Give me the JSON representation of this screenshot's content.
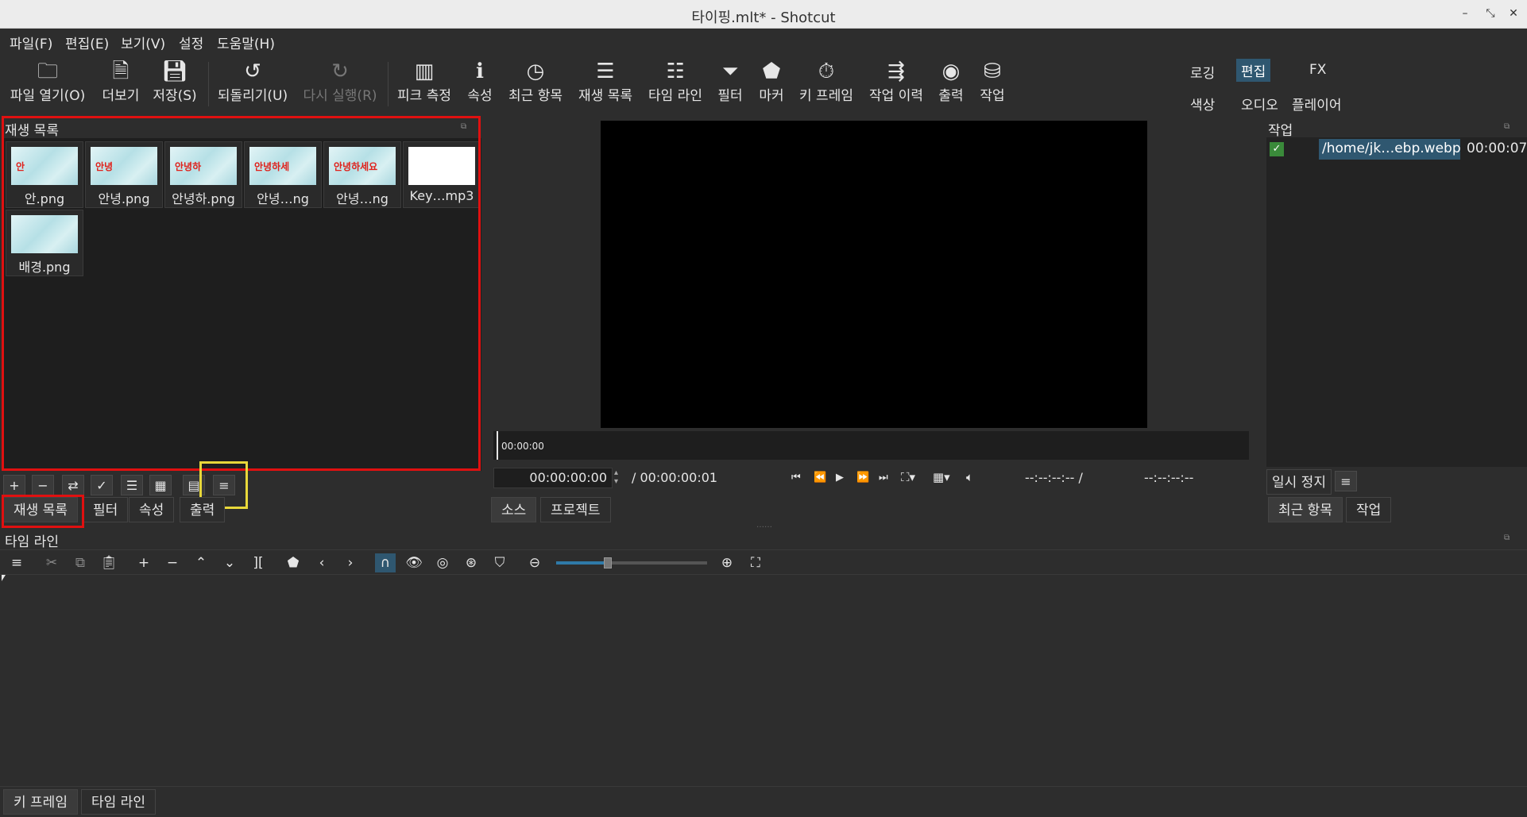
{
  "window": {
    "title": "타이핑.mlt* - Shotcut",
    "minimize_glyph": "–",
    "restore_glyph": "⤡",
    "close_glyph": "✕"
  },
  "menu": [
    "파일(F)",
    "편집(E)",
    "보기(V)",
    "설정",
    "도움말(H)"
  ],
  "toolbar": {
    "open": "파일 열기(O)",
    "more": "더보기",
    "save": "저장(S)",
    "undo": "되돌리기(U)",
    "redo": "다시 실행(R)",
    "peak": "피크 측정",
    "properties": "속성",
    "recent": "최근 항목",
    "playlist": "재생 목록",
    "timeline": "타임 라인",
    "filters": "필터",
    "markers": "마커",
    "keyframes": "키 프레임",
    "history": "작업 이력",
    "export": "출력",
    "jobs": "작업"
  },
  "layouts": {
    "logging": "로깅",
    "editing": "편집",
    "fx": "FX",
    "color": "색상",
    "audio": "오디오",
    "player": "플레이어"
  },
  "playlist": {
    "title": "재생 목록",
    "items": [
      {
        "label": "안.png",
        "thumb_text": "안"
      },
      {
        "label": "안녕.png",
        "thumb_text": "안녕"
      },
      {
        "label": "안녕하.png",
        "thumb_text": "안녕하"
      },
      {
        "label": "안녕…ng",
        "thumb_text": "안녕하세"
      },
      {
        "label": "안녕…ng",
        "thumb_text": "안녕하세요"
      },
      {
        "label": "Key…mp3",
        "thumb_text": ""
      },
      {
        "label": "배경.png",
        "thumb_text": ""
      }
    ],
    "menu_glyph": "≡"
  },
  "left_tabs": [
    "재생 목록",
    "필터",
    "속성",
    "출력"
  ],
  "player": {
    "scrub_time": "00:00:00",
    "current": "00:00:00:00",
    "duration": "/ 00:00:00:01",
    "in_point": "--:--:--:-- /",
    "out_point": "--:--:--:--",
    "tabs": [
      "소스",
      "프로젝트"
    ]
  },
  "jobs": {
    "title": "작업",
    "job_path": "/home/jk…ebp.webp",
    "job_time": "00:00:07",
    "pause": "일시 정지",
    "menu_glyph": "≡",
    "tabs": [
      "최근 항목",
      "작업"
    ]
  },
  "timeline": {
    "title": "타임 라인"
  },
  "bottom_tabs": [
    "키 프레임",
    "타임 라인"
  ],
  "colors": {
    "highlight": "#2f5770",
    "annotation_red": "#e01010",
    "annotation_yellow": "#e8d83a"
  }
}
